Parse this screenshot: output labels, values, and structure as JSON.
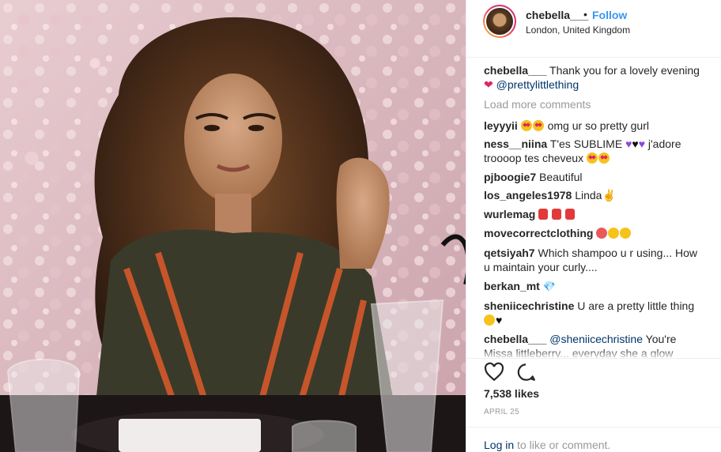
{
  "header": {
    "username": "chebella___",
    "separator": "•",
    "follow_label": "Follow",
    "location": "London, United Kingdom"
  },
  "caption": {
    "username": "chebella___",
    "text": "Thank you for a lovely evening",
    "heart": "❤",
    "mention": "@prettylittlething"
  },
  "load_more": "Load more comments",
  "comments": [
    {
      "user": "leyyyii",
      "emoji": [
        "heart-eyes",
        "heart-eyes"
      ],
      "text": "omg ur so pretty gurl"
    },
    {
      "user": "ness__niina",
      "text_a": "T'es SUBLIME",
      "text_b": "j'adore",
      "text_c": "troooop tes cheveux"
    },
    {
      "user": "pjboogie7",
      "text": "Beautiful"
    },
    {
      "user": "los_angeles1978",
      "text": "Linda",
      "emoji": "✌"
    },
    {
      "user": "wurlemag"
    },
    {
      "user": "movecorrectclothing"
    },
    {
      "user": "qetsiyah7",
      "text": "Which shampoo u r using... How u maintain your curly...."
    },
    {
      "user": "berkan_mt",
      "emoji": "💎"
    },
    {
      "user": "sheniicechristine",
      "text": "U are a pretty little thing"
    },
    {
      "user": "chebella___",
      "mention": "@sheniicechristine",
      "text": "You're Missa littleberry... everyday she a glow"
    }
  ],
  "likes": "7,538 likes",
  "date": "APRIL 25",
  "login": {
    "link": "Log in",
    "rest": "to like or comment."
  },
  "colors": {
    "link_blue": "#3897f0",
    "mention": "#003569",
    "muted": "#999999"
  }
}
